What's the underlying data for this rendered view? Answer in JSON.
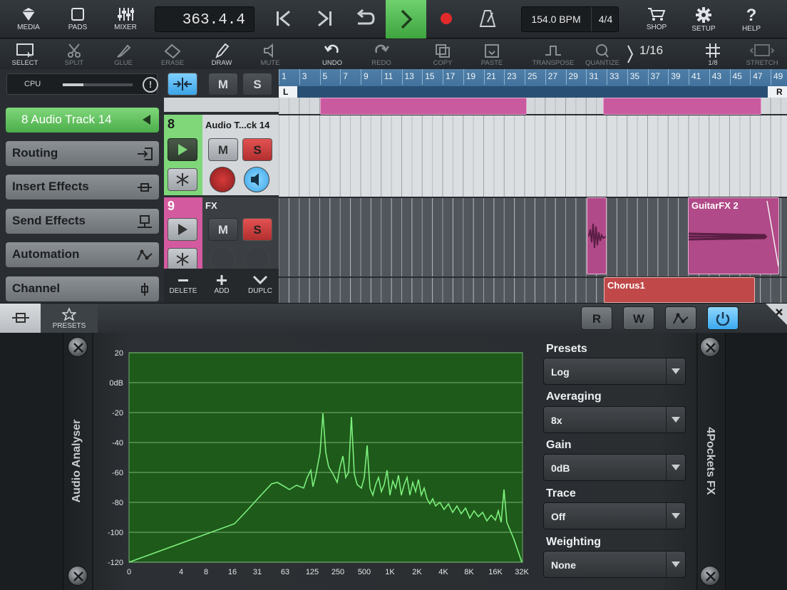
{
  "toolbar": {
    "media": "MEDIA",
    "pads": "PADS",
    "mixer": "MIXER",
    "position": "363.4.4",
    "bpm": "154.0 BPM",
    "time_signature": "4/4",
    "shop": "SHOP",
    "setup": "SETUP",
    "help": "HELP"
  },
  "edit_toolbar": {
    "select": "SELECT",
    "split": "SPLIT",
    "glue": "GLUE",
    "erase": "ERASE",
    "draw": "DRAW",
    "mute": "MUTE",
    "undo": "UNDO",
    "redo": "REDO",
    "copy": "COPY",
    "paste": "PASTE",
    "transpose": "TRANSPOSE",
    "quantize": "QUANTIZE",
    "quantize_value": "1/16",
    "grid_value": "1/8",
    "stretch": "STRETCH"
  },
  "left_panel": {
    "cpu_label": "CPU",
    "cpu_usage": 0.3,
    "selected_track": "8 Audio Track 14",
    "items": [
      {
        "label": "Routing"
      },
      {
        "label": "Insert Effects"
      },
      {
        "label": "Send Effects"
      },
      {
        "label": "Automation"
      },
      {
        "label": "Channel"
      }
    ]
  },
  "tracks": [
    {
      "number": "8",
      "name": "Audio T...ck 14",
      "color": "#7fd77a"
    },
    {
      "number": "9",
      "name": "FX",
      "color": "#d45aa0"
    }
  ],
  "track_footer": {
    "delete": "DELETE",
    "add": "ADD",
    "duplicate": "DUPLC"
  },
  "ruler": {
    "bars": [
      "1",
      "3",
      "5",
      "7",
      "9",
      "11",
      "13",
      "15",
      "17",
      "19",
      "21",
      "23",
      "25",
      "27",
      "29",
      "31",
      "33",
      "35",
      "37",
      "39",
      "41",
      "43",
      "45",
      "47",
      "49"
    ],
    "left_marker": "L",
    "right_marker": "R"
  },
  "clips": {
    "guitarfx": "GuitarFX 2",
    "chorus": "Chorus1"
  },
  "plugin_bar": {
    "presets_tab": "PRESETS"
  },
  "plugin": {
    "name": "Audio Analyser",
    "brand": "4Pockets FX",
    "y_ticks": [
      "20",
      "0dB",
      "-20",
      "-40",
      "-60",
      "-80",
      "-100",
      "-120"
    ],
    "x_ticks": [
      "0",
      "4",
      "8",
      "16",
      "31",
      "63",
      "125",
      "250",
      "500",
      "1K",
      "2K",
      "4K",
      "8K",
      "16K",
      "32K"
    ],
    "controls": [
      {
        "label": "Presets",
        "value": "Log"
      },
      {
        "label": "Averaging",
        "value": "8x"
      },
      {
        "label": "Gain",
        "value": "0dB"
      },
      {
        "label": "Trace",
        "value": "Off"
      },
      {
        "label": "Weighting",
        "value": "None"
      }
    ]
  },
  "colors": {
    "accent_green": "#5cc05a",
    "accent_blue": "#4aaef0",
    "graph_bg": "#1e5a1a",
    "graph_line": "#7cf07c"
  }
}
